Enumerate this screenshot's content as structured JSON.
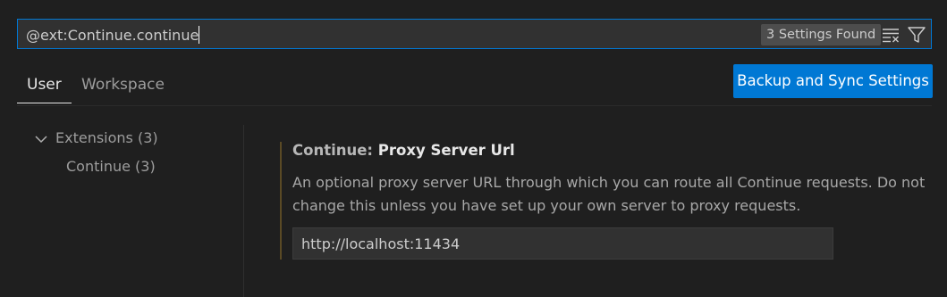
{
  "search": {
    "query": "@ext:Continue.continue",
    "results_badge": "3 Settings Found"
  },
  "tabs": [
    {
      "label": "User",
      "active": true
    },
    {
      "label": "Workspace",
      "active": false
    }
  ],
  "sync_button": {
    "label": "Backup and Sync Settings"
  },
  "toc": {
    "extensions_label": "Extensions (3)",
    "continue_label": "Continue (3)"
  },
  "setting": {
    "category": "Continue: ",
    "name": "Proxy Server Url",
    "description": "An optional proxy server URL through which you can route all Continue requests. Do not change this unless you have set up your own server to proxy requests.",
    "value": "http://localhost:11434"
  },
  "colors": {
    "accent": "#0078d4",
    "background": "#1f1f1f",
    "input_background": "#313131"
  },
  "icons": [
    "clear-filter-icon",
    "filter-icon",
    "chevron-down-icon"
  ]
}
